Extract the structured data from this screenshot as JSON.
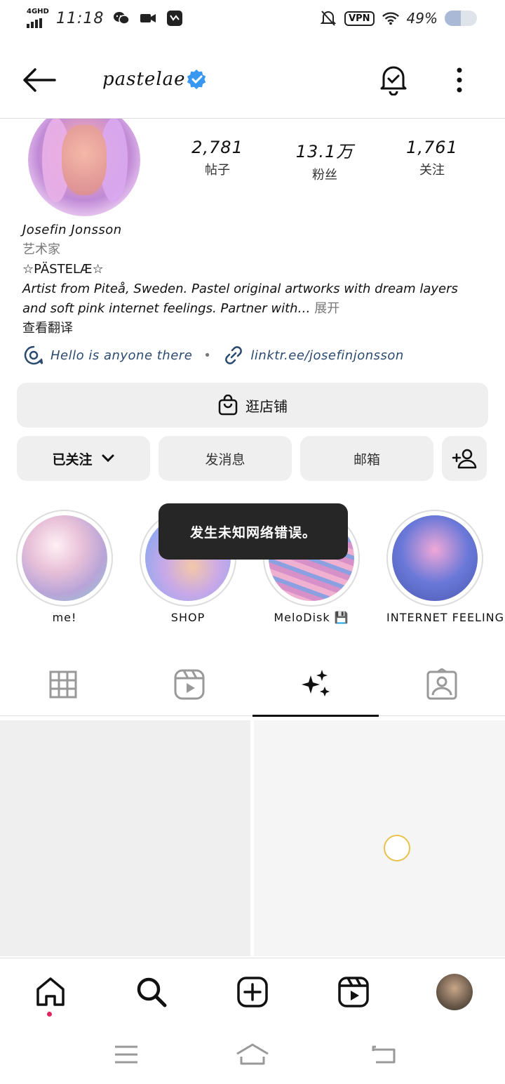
{
  "status_bar": {
    "network": "4GHD",
    "time": "11:18",
    "vpn": "VPN",
    "battery_pct": "49%",
    "battery_level": 0.49
  },
  "header": {
    "username": "pastelae",
    "icons": [
      "back-arrow-icon",
      "verified-icon",
      "bell-check-icon",
      "more-vertical-icon"
    ]
  },
  "stats": [
    {
      "value": "2,781",
      "label": "帖子"
    },
    {
      "value": "13.1万",
      "label": "粉丝"
    },
    {
      "value": "1,761",
      "label": "关注"
    }
  ],
  "bio": {
    "name": "Josefin Jonsson",
    "category": "艺术家",
    "title": "☆PÄSTELÆ☆",
    "text": "Artist from Piteå, Sweden. Pastel original artworks with dream layers and soft pink internet feelings. Partner with…",
    "more": "展开",
    "translate": "查看翻译"
  },
  "links": {
    "thread": "Hello is anyone there",
    "separator": "•",
    "url": "linktr.ee/josefinjonsson"
  },
  "buttons": {
    "shop": "逛店铺",
    "following": "已关注",
    "message": "发消息",
    "email": "邮箱"
  },
  "highlights": [
    {
      "label": "me!"
    },
    {
      "label": "SHOP"
    },
    {
      "label": "MeloDisk 💾"
    },
    {
      "label": "INTERNET FEELING"
    }
  ],
  "toast": "发生未知网络错误。",
  "tabs": [
    "grid-icon",
    "reels-icon",
    "sparkles-icon",
    "tagged-icon"
  ],
  "bottom_nav": [
    "home-icon",
    "search-icon",
    "create-icon",
    "reels-icon",
    "profile-avatar"
  ]
}
